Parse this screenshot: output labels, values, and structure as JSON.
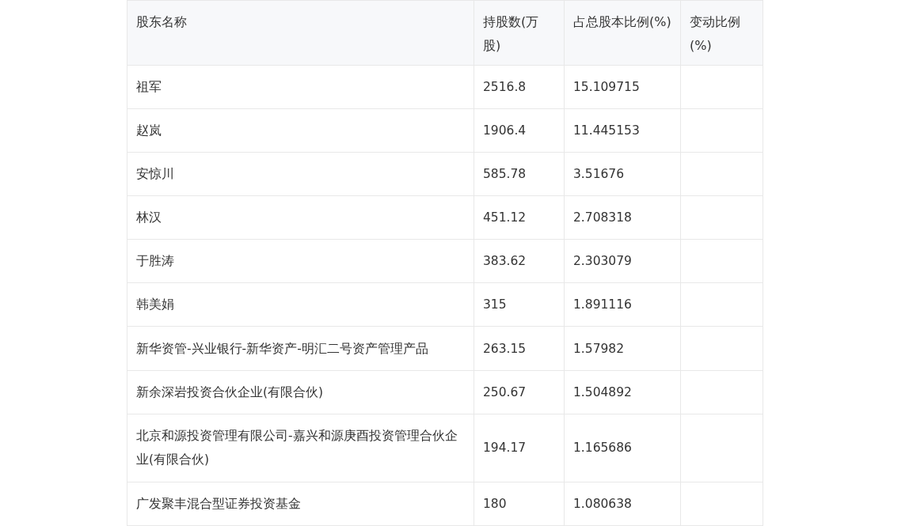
{
  "table": {
    "columns": [
      "股东名称",
      "持股数(万股)",
      "占总股本比例(%)",
      "变动比例(%)"
    ],
    "rows": [
      [
        "祖军",
        "2516.8",
        "15.109715",
        ""
      ],
      [
        "赵岚",
        "1906.4",
        "11.445153",
        ""
      ],
      [
        "安惊川",
        "585.78",
        "3.51676",
        ""
      ],
      [
        "林汉",
        "451.12",
        "2.708318",
        ""
      ],
      [
        "于胜涛",
        "383.62",
        "2.303079",
        ""
      ],
      [
        "韩美娟",
        "315",
        "1.891116",
        ""
      ],
      [
        "新华资管-兴业银行-新华资产-明汇二号资产管理产品",
        "263.15",
        "1.57982",
        ""
      ],
      [
        "新余深岩投资合伙企业(有限合伙)",
        "250.67",
        "1.504892",
        ""
      ],
      [
        "北京和源投资管理有限公司-嘉兴和源庚酉投资管理合伙企业(有限合伙)",
        "194.17",
        "1.165686",
        ""
      ],
      [
        "广发聚丰混合型证券投资基金",
        "180",
        "1.080638",
        ""
      ]
    ]
  }
}
